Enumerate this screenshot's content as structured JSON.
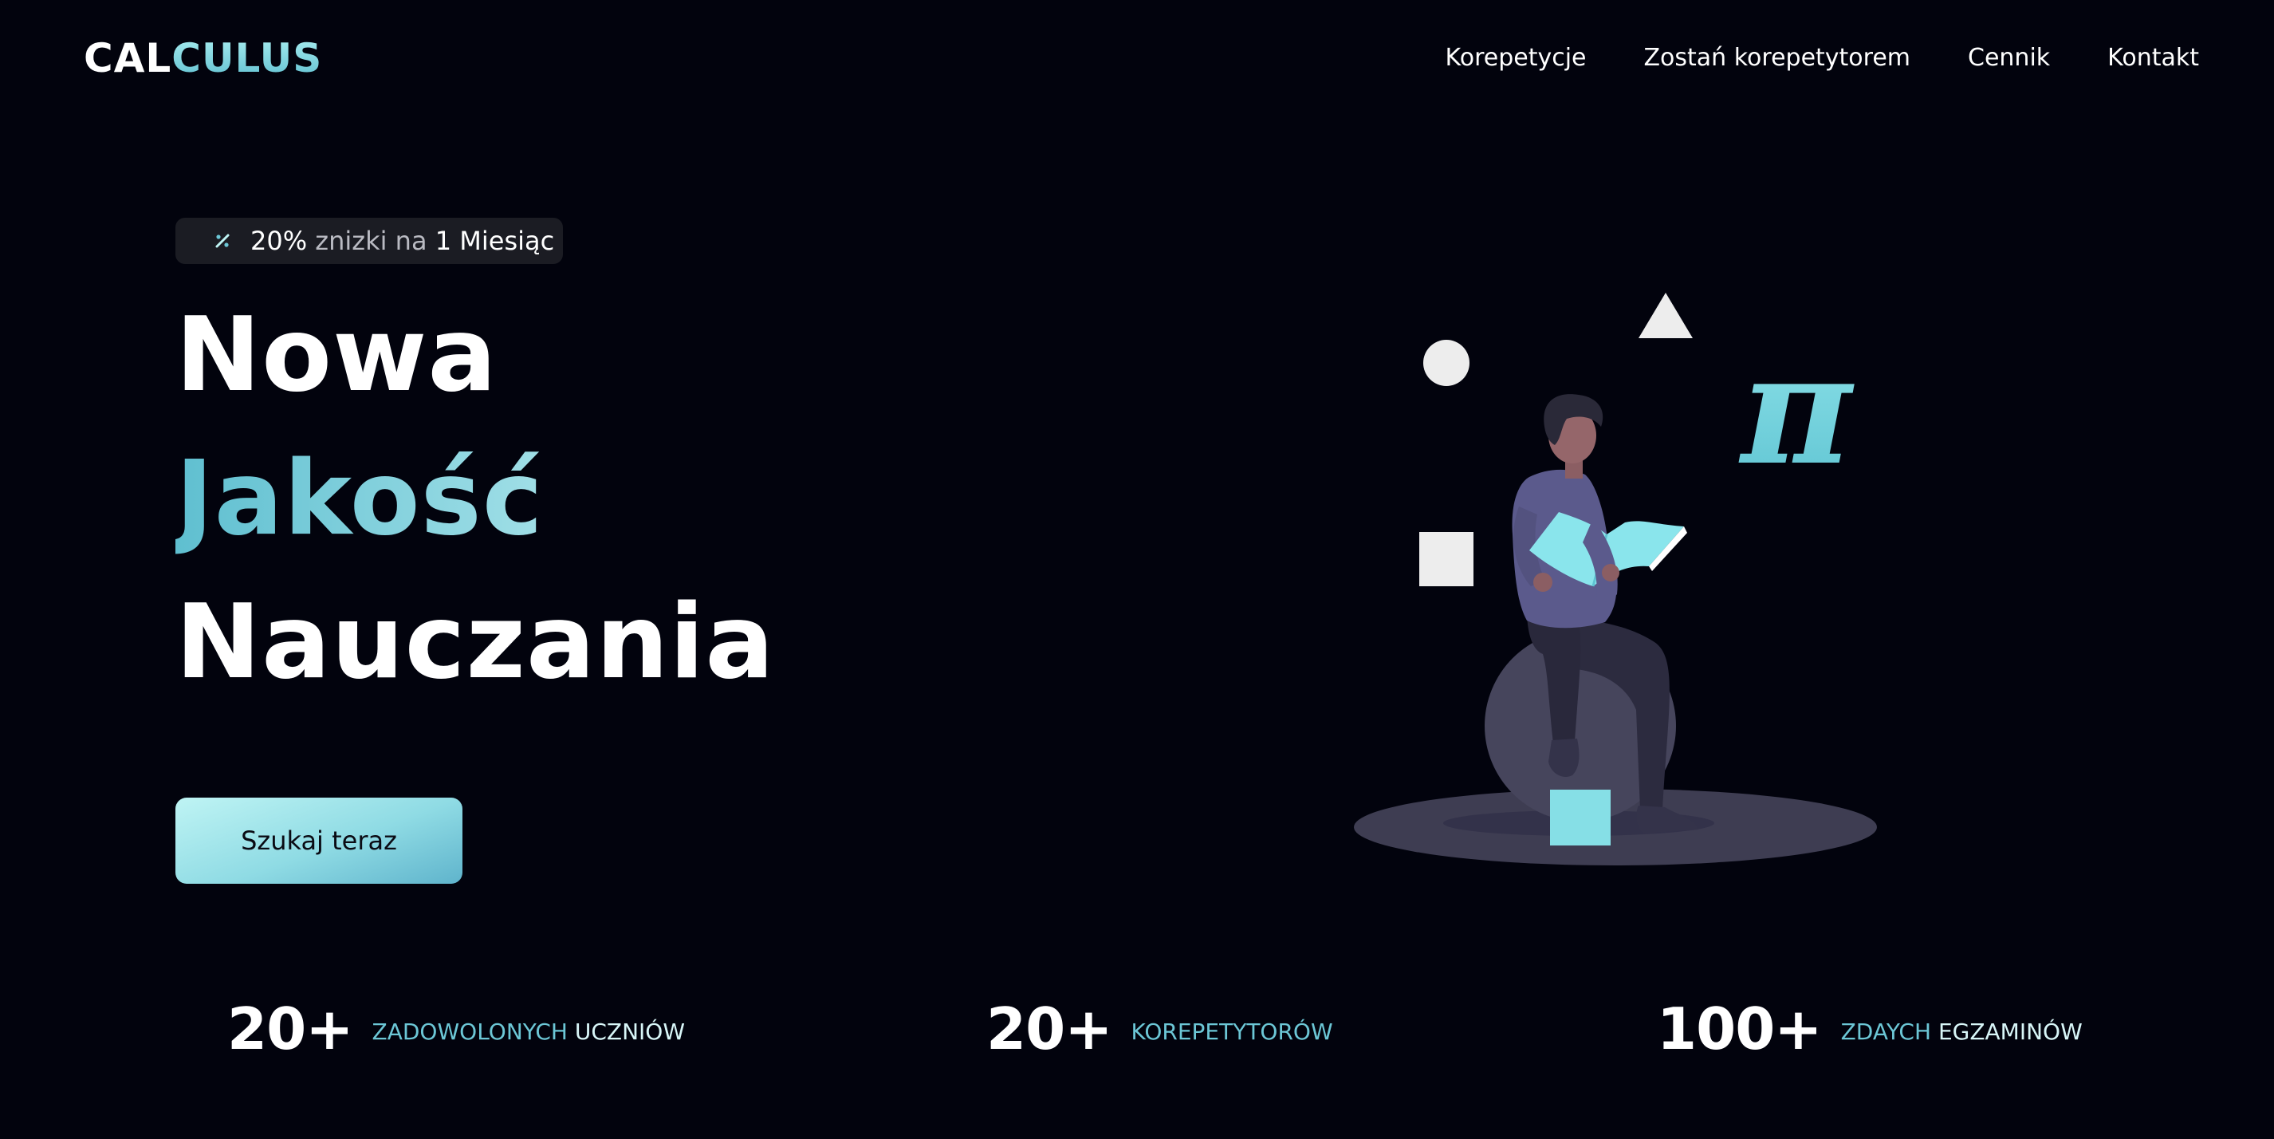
{
  "header": {
    "logo_part1": "CAL",
    "logo_part2": "CULUS",
    "nav": [
      {
        "label": "Korepetycje"
      },
      {
        "label": "Zostań korepetytorem"
      },
      {
        "label": "Cennik"
      },
      {
        "label": "Kontakt"
      }
    ]
  },
  "promo": {
    "icon": "percent-icon",
    "percent": "20%",
    "middle": " znizki na ",
    "end": "1 Miesiąc"
  },
  "hero": {
    "line1": "Nowa",
    "line2": "Jakość",
    "line3": "Nauczania"
  },
  "cta": {
    "label": "Szukaj teraz"
  },
  "stats": [
    {
      "number": "20+",
      "label_part1": "ZADOWOLONYCH",
      "label_part2": " UCZNIÓW"
    },
    {
      "number": "20+",
      "label_part1": "KOREPETYTORÓW",
      "label_part2": ""
    },
    {
      "number": "100+",
      "label_part1": "ZDAYCH",
      "label_part2": " EGZAMINÓW"
    }
  ],
  "illustration": {
    "symbol": "π"
  },
  "colors": {
    "background": "#02030d",
    "accent": "#6cc7d6",
    "accent_light": "#bff4f4",
    "badge_bg": "#1b1c23",
    "figure_shirt": "#5b5a8c",
    "platform": "#3d3c52"
  }
}
